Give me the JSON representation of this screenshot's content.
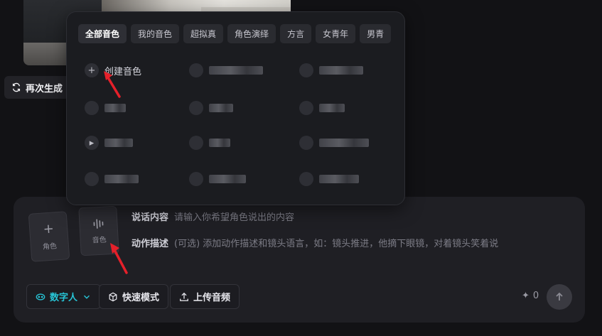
{
  "regenerate": {
    "label": "再次生成",
    "icon": "refresh-icon"
  },
  "composer": {
    "card_role": {
      "label": "角色",
      "icon": "plus-icon"
    },
    "card_voice": {
      "label": "音色",
      "icon": "waveform-icon"
    },
    "speech": {
      "label": "说话内容",
      "placeholder": "请输入你希望角色说出的内容"
    },
    "action": {
      "label": "动作描述",
      "placeholder": "(可选) 添加动作描述和镜头语言，如：镜头推进，他摘下眼镜，对着镜头笑着说"
    },
    "tools": [
      {
        "label": "数字人",
        "icon": "face-icon"
      },
      {
        "label": "快速模式",
        "icon": "cube-icon"
      },
      {
        "label": "上传音频",
        "icon": "upload-icon"
      }
    ],
    "credits": {
      "icon": "sparkle-icon",
      "value": "0"
    }
  },
  "voice_popup": {
    "tabs": [
      "全部音色",
      "我的音色",
      "超拟真",
      "角色演绎",
      "方言",
      "女青年",
      "男青"
    ],
    "create_label": "创建音色",
    "create_icon": "plus-icon"
  },
  "colors": {
    "accent": "#27c4d6",
    "annotation_arrow": "#e5202a",
    "background": "#121215"
  }
}
